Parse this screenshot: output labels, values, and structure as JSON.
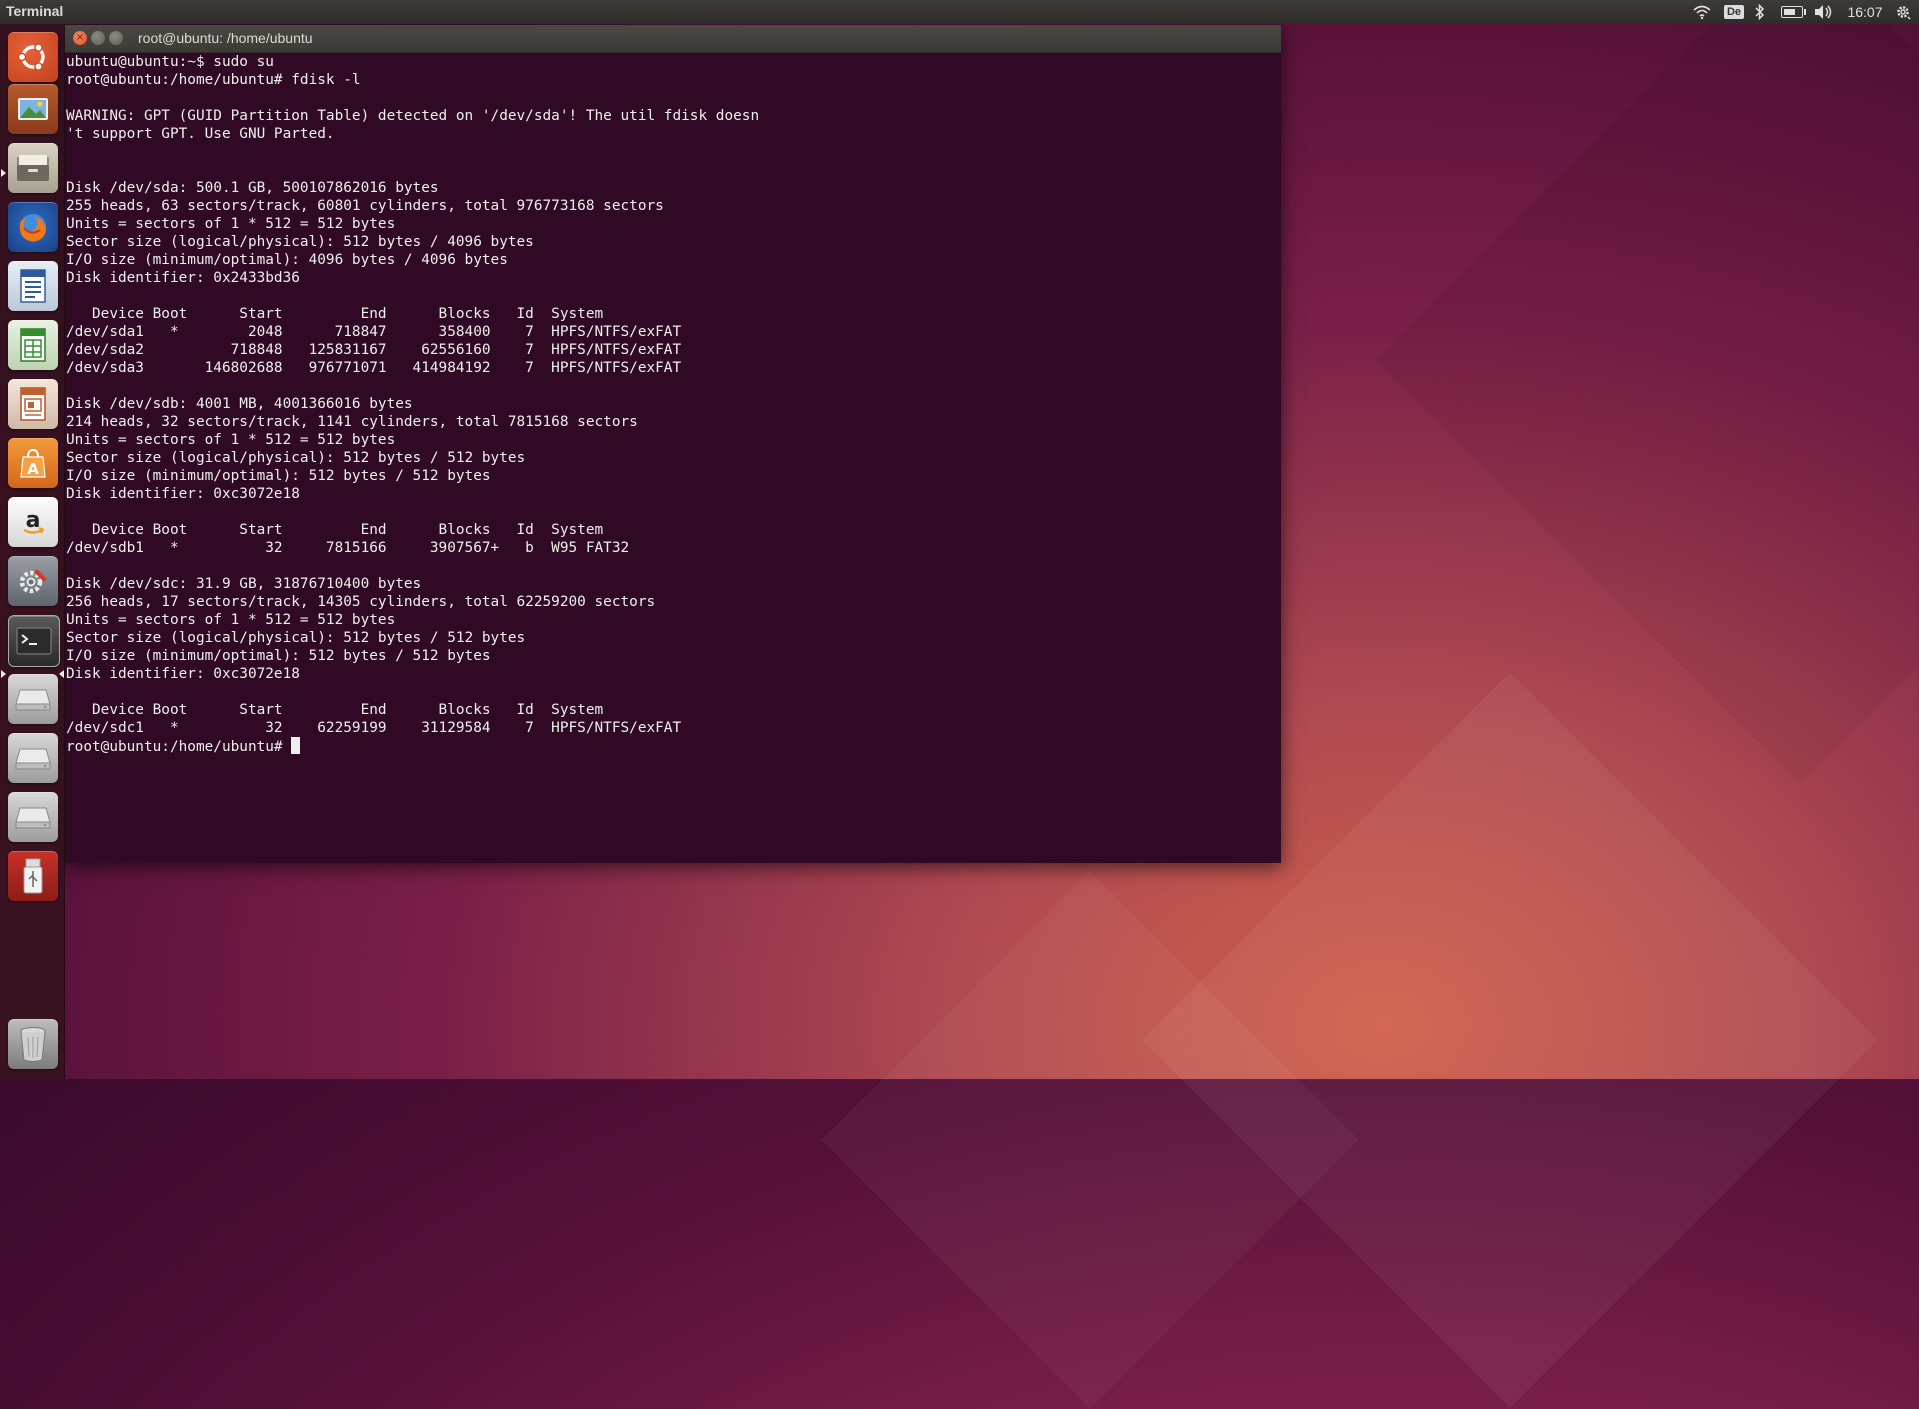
{
  "top_panel": {
    "app_title": "Terminal",
    "keyboard_layout": "De",
    "clock": "16:07",
    "battery_level": 0.7,
    "icons": [
      "wifi-icon",
      "keyboard-layout-indicator",
      "bluetooth-icon",
      "battery-icon",
      "volume-icon",
      "gear-icon"
    ]
  },
  "launcher": {
    "items": [
      {
        "name": "ubuntu-dash-icon"
      },
      {
        "name": "image-viewer-icon"
      },
      {
        "name": "files-icon"
      },
      {
        "name": "firefox-icon"
      },
      {
        "name": "libreoffice-writer-icon"
      },
      {
        "name": "libreoffice-calc-icon"
      },
      {
        "name": "libreoffice-impress-icon"
      },
      {
        "name": "software-center-icon"
      },
      {
        "name": "amazon-icon"
      },
      {
        "name": "system-settings-icon"
      },
      {
        "name": "terminal-icon"
      },
      {
        "name": "drive-icon-1"
      },
      {
        "name": "drive-icon-2"
      },
      {
        "name": "drive-icon-3"
      },
      {
        "name": "usb-drive-icon"
      },
      {
        "name": "trash-icon"
      }
    ]
  },
  "window": {
    "title": "root@ubuntu: /home/ubuntu"
  },
  "terminal": {
    "output": "ubuntu@ubuntu:~$ sudo su\nroot@ubuntu:/home/ubuntu# fdisk -l\n\nWARNING: GPT (GUID Partition Table) detected on '/dev/sda'! The util fdisk doesn\n't support GPT. Use GNU Parted.\n\n\nDisk /dev/sda: 500.1 GB, 500107862016 bytes\n255 heads, 63 sectors/track, 60801 cylinders, total 976773168 sectors\nUnits = sectors of 1 * 512 = 512 bytes\nSector size (logical/physical): 512 bytes / 4096 bytes\nI/O size (minimum/optimal): 4096 bytes / 4096 bytes\nDisk identifier: 0x2433bd36\n\n   Device Boot      Start         End      Blocks   Id  System\n/dev/sda1   *        2048      718847      358400    7  HPFS/NTFS/exFAT\n/dev/sda2          718848   125831167    62556160    7  HPFS/NTFS/exFAT\n/dev/sda3       146802688   976771071   414984192    7  HPFS/NTFS/exFAT\n\nDisk /dev/sdb: 4001 MB, 4001366016 bytes\n214 heads, 32 sectors/track, 1141 cylinders, total 7815168 sectors\nUnits = sectors of 1 * 512 = 512 bytes\nSector size (logical/physical): 512 bytes / 512 bytes\nI/O size (minimum/optimal): 512 bytes / 512 bytes\nDisk identifier: 0xc3072e18\n\n   Device Boot      Start         End      Blocks   Id  System\n/dev/sdb1   *          32     7815166     3907567+   b  W95 FAT32\n\nDisk /dev/sdc: 31.9 GB, 31876710400 bytes\n256 heads, 17 sectors/track, 14305 cylinders, total 62259200 sectors\nUnits = sectors of 1 * 512 = 512 bytes\nSector size (logical/physical): 512 bytes / 512 bytes\nI/O size (minimum/optimal): 512 bytes / 512 bytes\nDisk identifier: 0xc3072e18\n\n   Device Boot      Start         End      Blocks   Id  System\n/dev/sdc1   *          32    62259199    31129584    7  HPFS/NTFS/exFAT",
    "prompt": "root@ubuntu:/home/ubuntu# "
  }
}
